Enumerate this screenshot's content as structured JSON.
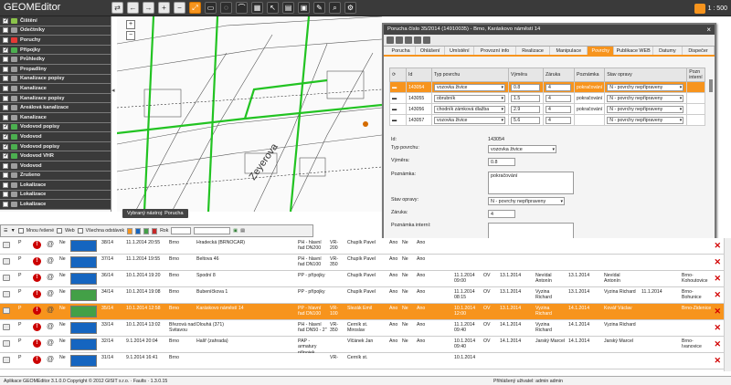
{
  "app": {
    "title": "GEOMEditor",
    "scale": "1 : 500"
  },
  "toolbar": {
    "icons": [
      "swap-icon",
      "back-icon",
      "forward-icon",
      "plus-icon",
      "minus-icon",
      "fit-icon",
      "select-icon",
      "lasso-icon",
      "measure-icon",
      "layer-icon",
      "cursor-icon",
      "print-icon",
      "save-icon",
      "edit-icon",
      "search-icon",
      "settings-icon"
    ]
  },
  "layers": [
    {
      "label": "Čištění",
      "checked": true,
      "color": "#8bc34a"
    },
    {
      "label": "Odečtníky",
      "checked": false,
      "color": "#9e9e9e"
    },
    {
      "label": "Poruchy",
      "checked": false,
      "color": "#e53935"
    },
    {
      "label": "Přípojky",
      "checked": true,
      "color": "#4caf50"
    },
    {
      "label": "Průhledky",
      "checked": false,
      "color": "#9e9e9e"
    },
    {
      "label": "Propadliny",
      "checked": false,
      "color": "#9e9e9e"
    },
    {
      "label": "Kanalizace popisy",
      "checked": false,
      "color": "#9e9e9e"
    },
    {
      "label": "Kanalizace",
      "checked": false,
      "color": "#9e9e9e"
    },
    {
      "label": "Kanalizace popisy",
      "checked": false,
      "color": "#9e9e9e"
    },
    {
      "label": "Areálová kanalizace",
      "checked": false,
      "color": "#9e9e9e"
    },
    {
      "label": "Kanalizace",
      "checked": false,
      "color": "#9e9e9e"
    },
    {
      "label": "Vodovod popisy",
      "checked": true,
      "color": "#4caf50"
    },
    {
      "label": "Vodovod",
      "checked": true,
      "color": "#4caf50"
    },
    {
      "label": "Vodovod popisy",
      "checked": true,
      "color": "#4caf50"
    },
    {
      "label": "Vodovod VHR",
      "checked": true,
      "color": "#4caf50"
    },
    {
      "label": "Vodovod",
      "checked": false,
      "color": "#9e9e9e"
    },
    {
      "label": "Zrušeno",
      "checked": false,
      "color": "#9e9e9e"
    },
    {
      "label": "Lokalizace",
      "checked": false,
      "color": "#9e9e9e"
    },
    {
      "label": "Lokalizace",
      "checked": false,
      "color": "#9e9e9e"
    },
    {
      "label": "Lokalizace",
      "checked": false,
      "color": "#9e9e9e"
    }
  ],
  "map": {
    "street": "Zeyerova",
    "caption": "Vybraný nástroj: Porucha"
  },
  "dialog": {
    "title": "Porucha číslo 35/2014 (14910035) - Brno, Karáskovo náměstí 14",
    "tabs": [
      "Porucha",
      "Ohlášení",
      "Umístění",
      "Provozní info",
      "Realizace",
      "Manipulace",
      "Povrchy",
      "Publikace WEB",
      "Datumy",
      "Dispečer"
    ],
    "active_tab": 6,
    "table": {
      "headers": [
        "Id",
        "Typ povrchu",
        "Výměra",
        "Záruka",
        "Poznámka",
        "Stav opravy",
        "Pozn interní"
      ],
      "rows": [
        {
          "id": "143054",
          "typ": "vozovka živice",
          "vymera": "0.8",
          "zaruka": "4",
          "pozn": "pokračování",
          "stav": "N - povrchy nepřipraveny",
          "selected": true
        },
        {
          "id": "143055",
          "typ": "obrubník",
          "vymera": "1.5",
          "zaruka": "4",
          "pozn": "pokračování",
          "stav": "N - povrchy nepřipraveny",
          "selected": false
        },
        {
          "id": "143056",
          "typ": "chodník zámková dlažba",
          "vymera": "2.9",
          "zaruka": "4",
          "pozn": "pokračování",
          "stav": "N - povrchy nepřipraveny",
          "selected": false
        },
        {
          "id": "143057",
          "typ": "vozovka živice",
          "vymera": "5.6",
          "zaruka": "4",
          "pozn": "",
          "stav": "N - povrchy nepřipraveny",
          "selected": false
        }
      ]
    },
    "form": {
      "id_label": "Id:",
      "id_value": "143054",
      "typ_label": "Typ povrchu:",
      "typ_value": "vozovka živice",
      "vymera_label": "Výměra:",
      "vymera_value": "0.8",
      "poznamka_label": "Poznámka:",
      "poznamka_value": "pokračování",
      "stav_label": "Stav opravy:",
      "stav_value": "N - povrchy nepřipraveny",
      "zaruka_label": "Záruka:",
      "zaruka_value": "4",
      "interni_label": "Poznámka interní:",
      "interni_value": ""
    }
  },
  "gridbar": {
    "labels": [
      "Mnou řešené",
      "Web",
      "Všechna odstávek",
      "Rok"
    ]
  },
  "grid_rows": [
    {
      "p": "P",
      "ne": "Ne",
      "cislo": "38/14",
      "datum": "11.1.2014 20:55",
      "obec": "Brno",
      "ulice": "Hradecká (BRNOCAR)",
      "druh": "PH - hlavní řad DN200",
      "vr": "VR-200",
      "jmeno": "Chupík Pavel",
      "a": "Ano",
      "b": "Ne",
      "c": "Ano",
      "d": "",
      "ov": "",
      "e": "",
      "f": "",
      "g": "",
      "h": "",
      "i": "",
      "j": "",
      "k": "",
      "selected": false,
      "stat": "#1565c0"
    },
    {
      "p": "P",
      "ne": "Ne",
      "cislo": "37/14",
      "datum": "11.1.2014 19:55",
      "obec": "Brno",
      "ulice": "Beltova 46",
      "druh": "PH - hlavní řad DN100",
      "vr": "VR-350",
      "jmeno": "Chupík Pavel",
      "a": "Ano",
      "b": "Ne",
      "c": "Ano",
      "d": "",
      "ov": "",
      "e": "",
      "f": "",
      "g": "",
      "h": "",
      "i": "",
      "j": "",
      "k": "",
      "selected": false,
      "stat": "#1565c0"
    },
    {
      "p": "P",
      "ne": "Ne",
      "cislo": "36/14",
      "datum": "10.1.2014 19:20",
      "obec": "Brno",
      "ulice": "Spodní 8",
      "druh": "PP - přípojky",
      "vr": "",
      "jmeno": "Chupík Pavel",
      "a": "Ano",
      "b": "Ne",
      "c": "Ano",
      "d": "11.1.2014 09:00",
      "ov": "OV",
      "e": "13.1.2014",
      "f": "Nevídal Antonín",
      "g": "13.1.2014",
      "h": "Nevídal Antonín",
      "i": "",
      "j": "",
      "k": "Brno-Kohoutovice",
      "selected": false,
      "stat": "#1565c0"
    },
    {
      "p": "P",
      "ne": "Ne",
      "cislo": "34/14",
      "datum": "10.1.2014 19:08",
      "obec": "Brno",
      "ulice": "Bubeníčkova 1",
      "druh": "PP - přípojky",
      "vr": "",
      "jmeno": "Chupík Pavel",
      "a": "Ano",
      "b": "Ne",
      "c": "Ano",
      "d": "11.1.2014 08:15",
      "ov": "OV",
      "e": "13.1.2014",
      "f": "Vyzina Richard",
      "g": "13.1.2014",
      "h": "Vyzina Richard",
      "i": "11.1.2014",
      "j": "",
      "k": "Brno-Bohunice",
      "selected": false,
      "stat": "#43a047"
    },
    {
      "p": "P",
      "ne": "Ne",
      "cislo": "35/14",
      "datum": "10.1.2014 12:58",
      "obec": "Brno",
      "ulice": "Karáskovo náměstí 14",
      "druh": "PP - hlavní řad DN100",
      "vr": "VR-100",
      "jmeno": "Slezák Emil",
      "a": "Ano",
      "b": "Ne",
      "c": "Ano",
      "d": "10.1.2014 12:00",
      "ov": "OV",
      "e": "13.1.2014",
      "f": "Vyzina Richard",
      "g": "14.1.2014",
      "h": "Kovář Václav",
      "i": "",
      "j": "",
      "k": "Brno-Židenice",
      "selected": true,
      "stat": "#43a047"
    },
    {
      "p": "P",
      "ne": "Ne",
      "cislo": "33/14",
      "datum": "10.1.2014 13:02",
      "obec": "Březová nad Svitavou",
      "ulice": "Dlouhá (371)",
      "druh": "PH - hlavní řad DN50 - 2\"",
      "vr": "VR-350",
      "jmeno": "Černík st. Miroslav",
      "a": "Ano",
      "b": "Ne",
      "c": "Ano",
      "d": "11.1.2014 09:40",
      "ov": "OV",
      "e": "14.1.2014",
      "f": "Vyzina Richard",
      "g": "14.1.2014",
      "h": "Vyzina Richard",
      "i": "",
      "j": "",
      "k": "",
      "selected": false,
      "stat": "#1565c0"
    },
    {
      "p": "P",
      "ne": "Ne",
      "cislo": "32/14",
      "datum": "9.1.2014 20:04",
      "obec": "Brno",
      "ulice": "Halíř (zahrada)",
      "druh": "PAP - armatury přípojek",
      "vr": "",
      "jmeno": "Vlčánek Jan",
      "a": "Ano",
      "b": "Ne",
      "c": "Ano",
      "d": "10.1.2014 09:40",
      "ov": "OV",
      "e": "14.1.2014",
      "f": "Jarský Marcel",
      "g": "14.1.2014",
      "h": "Jarský Marcel",
      "i": "",
      "j": "",
      "k": "Brno-Ivanovice",
      "selected": false,
      "stat": "#1565c0"
    },
    {
      "p": "P",
      "ne": "Ne",
      "cislo": "31/14",
      "datum": "9.1.2014 16:41",
      "obec": "Brno",
      "ulice": "",
      "druh": "",
      "vr": "VR-",
      "jmeno": "Černík st.",
      "a": "",
      "b": "",
      "c": "",
      "d": "10.1.2014",
      "ov": "",
      "e": "",
      "f": "",
      "g": "",
      "h": "",
      "i": "",
      "j": "",
      "k": "",
      "selected": false,
      "stat": "#1565c0"
    }
  ],
  "status": {
    "left": "Aplikace GEOMEditor 3.1.0.0 Copyright © 2012 GISIT s.r.o. · Faults · 1.3.0.15",
    "user": "Přihlášený uživatel: admin admin"
  }
}
